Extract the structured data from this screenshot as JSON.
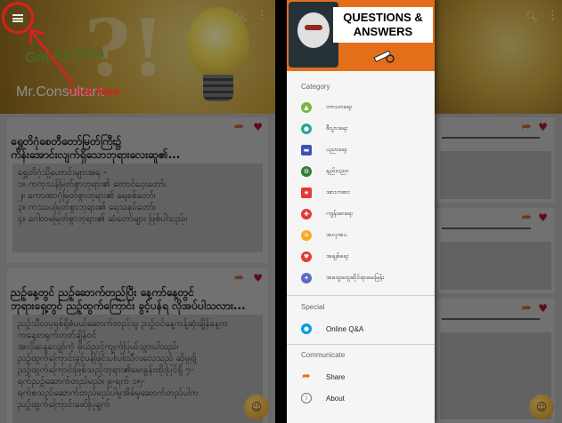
{
  "left_screen": {
    "banner": {
      "headline": "Got An Idea",
      "username": "Mr.Consultant"
    },
    "annotation": {
      "text": "Click Here"
    },
    "cards": [
      {
        "title": [
          "ရွှေတိဂုံစေတီတော်မြတ်ကြီး၌",
          "ကိန်းအောင်းလျက်ရှိသောဘုရားလေးဆူ၏..."
        ],
        "body": [
          "ရွှေတိဂုံသို့ဟောင်းများအရ -",
          "၁။ ကကုသန်မြတ်စွာဘုရား၏ တောင်ဝှေးတော်၊",
          "၂။ ကောဏာဂုံမြတ်စွာဘုရား၏ ရေစစ်တော်၊",
          "၃။ ကဿပမြတ်စွာဘုရား၏ ရေသနပ်တော်၊",
          "၄။ ဂေါတမမြတ်စွာဘုရား၏ ဆံတော်များ ဖြစ်ပါသည်။"
        ]
      },
      {
        "title": [
          "ညဉ့်နေ့တွင် ညဉ့်ဆောက်တည်ပြီး နေ့ကာ်နေ့တွင်",
          "ဘုရားရှေ့တွင် ညဉ့်ထွက်ကြောင်း ခွင့်ပန်ရ လိုအပ်ပါသလား..."
        ],
        "body": [
          "ညဉ့်သီလပုရစ်ရှိစံပယ်ဆောက်တည်သူ ညဉ့်ဝင်နေ့ကန့်ဆုံးချိန်နေ့က",
          "ကနေ့တရုက်တတ်ချိန်ဝင်",
          "အလိုဆန္ဒလျော်ကဲ့ မိုယ်ညှင့်ကျက်ပြယ်သွားပါသည်၊",
          "ညဉ့်ထွက်ကြောင်းခွင့်ပန်ဖြင်းပါးပါးသီလလေသည် ဆိုမှု၍",
          "ညဉ့်ထွက်ကြောင်းဖြစ်သည့်ဘုရား၏မေးခွန်းထိုးပြင်ရှိ ၇-",
          "ရက်ညဉ့်ဆောက်တည်မည်။ ၉-ရက် ၁၅-",
          "ရက်စသည်ဆောက်တည်မည်ပါမှုအိမ်မှုဆောက်တည်ပါက",
          "ညဉ့်ထွက်ကြောင်းဖော်ပြချက်"
        ]
      }
    ]
  },
  "drawer": {
    "header": {
      "title_line1": "QUESTIONS &",
      "title_line2": "ANSWERS"
    },
    "category_heading": "Category",
    "categories": [
      {
        "label": "ဘာသာရေး",
        "color": "#7cb342",
        "icon": "lotus-icon"
      },
      {
        "label": "စီးပွားရေး",
        "color": "#26a69a",
        "icon": "money-icon"
      },
      {
        "label": "ပညာရေး",
        "color": "#3f51b5",
        "icon": "book-icon"
      },
      {
        "label": "နည်းပညာ",
        "color": "#2e7d32",
        "icon": "gear-icon"
      },
      {
        "label": "အားကစား",
        "color": "#e53935",
        "icon": "runner-icon"
      },
      {
        "label": "ကျန်းမာရေး",
        "color": "#e53935",
        "icon": "health-cross-icon"
      },
      {
        "label": "အလှအပ",
        "color": "#f9a825",
        "icon": "sun-icon"
      },
      {
        "label": "အချစ်ရေး",
        "color": "#e53935",
        "icon": "heart-icon"
      },
      {
        "label": "အထွေထွေဆိုင်ရာမေးမြန်း",
        "color": "#5c6bc0",
        "icon": "misc-icon"
      }
    ],
    "special_heading": "Special",
    "special_items": [
      {
        "label": "Online Q&A",
        "color": "#039be5",
        "icon": "chat-icon"
      }
    ],
    "communicate_heading": "Communicate",
    "communicate_items": [
      {
        "label": "Share",
        "color": "#e46f1b",
        "icon": "share-icon"
      },
      {
        "label": "About",
        "color": "#757575",
        "icon": "info-icon"
      }
    ]
  },
  "colors": {
    "accent": "#e46f1b",
    "annotation": "#e01e1e",
    "heart": "#a3142f"
  }
}
